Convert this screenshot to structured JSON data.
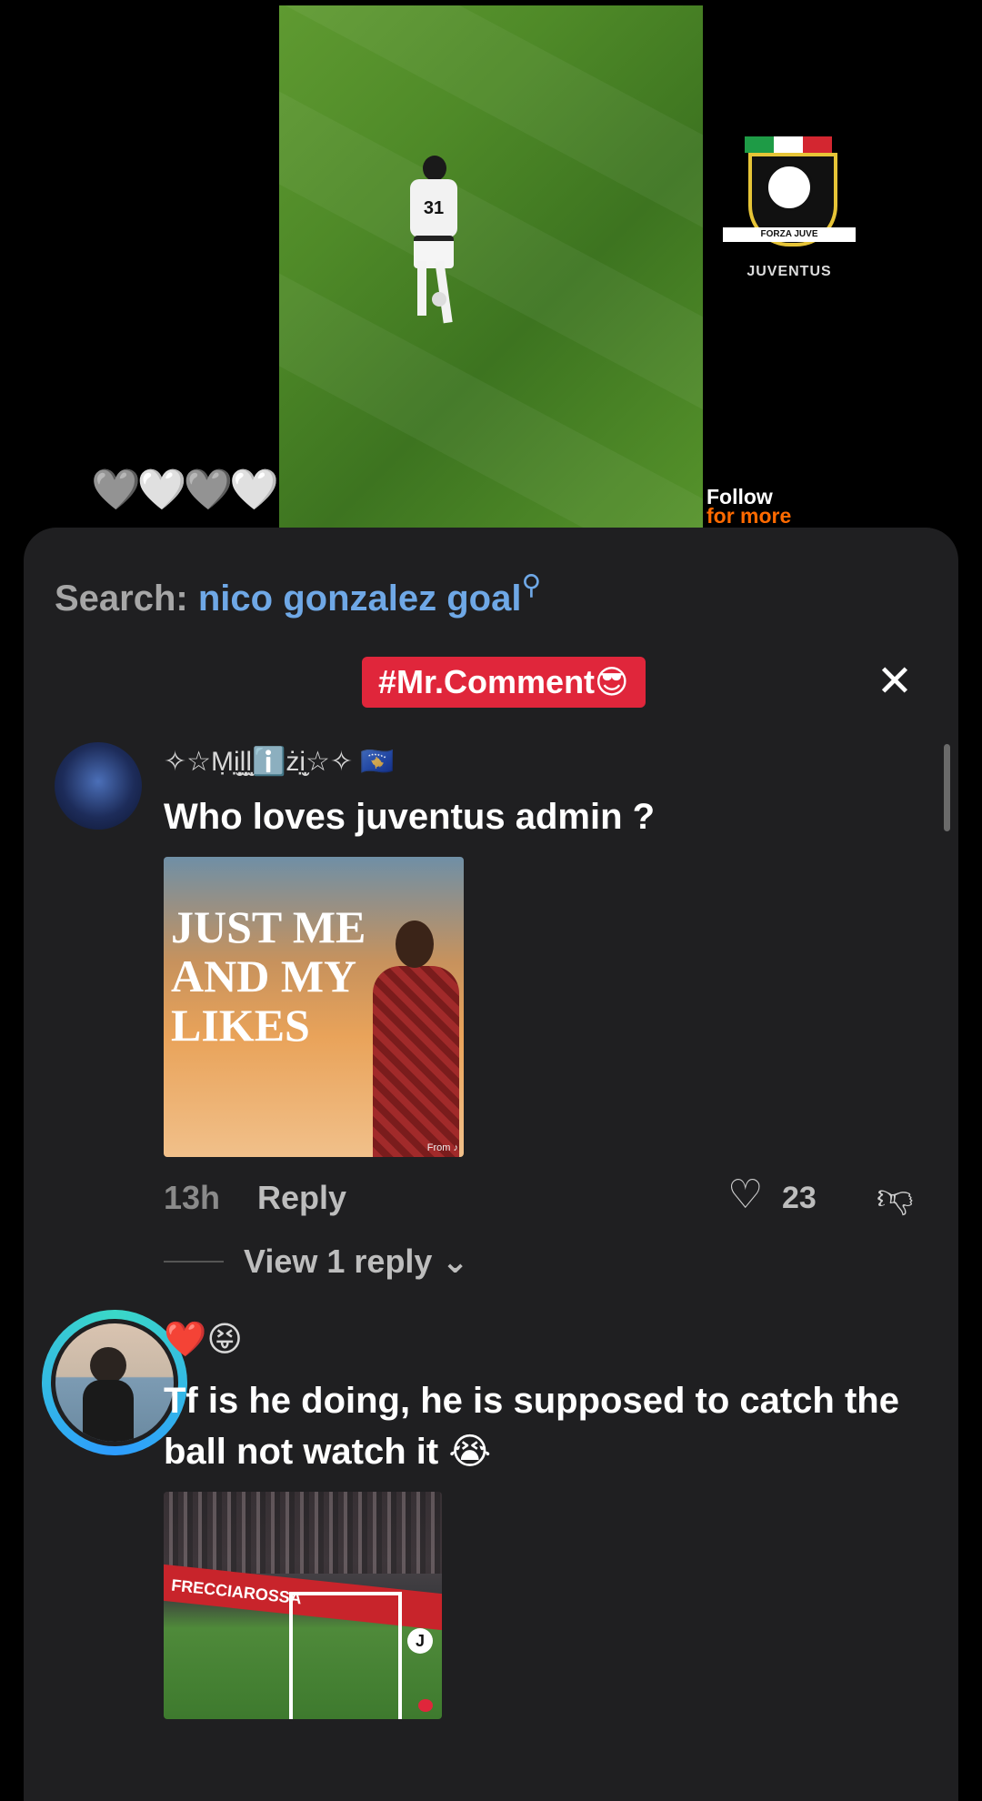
{
  "video": {
    "hearts": "🩶🤍🩶🤍",
    "jersey_number": "31",
    "logo": {
      "ribbon": "FORZA JUVE",
      "caption": "JUVENTUS",
      "flag_colors": [
        "#1e9b46",
        "#ffffff",
        "#d32630"
      ]
    },
    "follow_line1": "Follow",
    "follow_line2": "for more"
  },
  "panel": {
    "search_label": "Search:",
    "search_query": "nico gonzalez goal",
    "search_icon": "magnifier-icon",
    "tag": "#Mr.Comment😎",
    "close_icon": "✕"
  },
  "comments": [
    {
      "username": "✧☆Ṃi̤̮l̤̮l̤̮ℹ️żi̤̮☆✧ 🇽🇰",
      "text": "Who loves juventus admin ?",
      "image_text": "JUST ME\nAND MY\nLIKES",
      "image_source": "From ♪",
      "time": "13h",
      "reply_label": "Reply",
      "like_count": "23",
      "view_replies": "View 1 reply ⌄"
    },
    {
      "username": "❤️😝",
      "text": "Tf is he doing, he is supposed to catch the ball not watch it 😭",
      "image_text": "FRECCIAROSSA",
      "image_badge": "J"
    }
  ],
  "colors": {
    "accent_tag": "#e0263b",
    "search_query": "#6fa8e6",
    "panel_bg": "#1f1f21",
    "follow_accent": "#ff6a00"
  }
}
